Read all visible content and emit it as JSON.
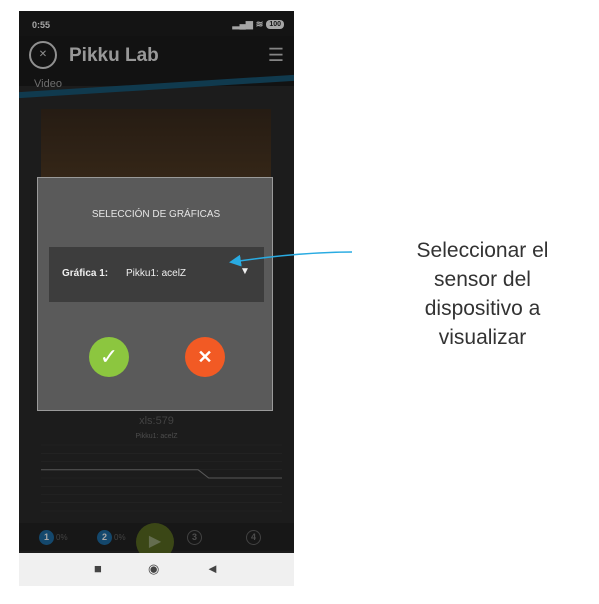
{
  "status": {
    "time": "0:55",
    "signal_icon": "signal-icon",
    "wifi_icon": "wifi-icon",
    "battery": "100"
  },
  "app": {
    "title": "Pikku Lab",
    "subtitle": "Video",
    "logo_icon": "pikku-logo-icon",
    "settings_icon": "sliders-icon"
  },
  "dialog": {
    "title": "SELECCIÓN DE GRÁFICAS",
    "graph_label": "Gráfica 1:",
    "graph_value": "Pikku1: acelZ",
    "confirm_icon": "check-icon",
    "cancel_icon": "close-icon"
  },
  "chart": {
    "header": "xls:579",
    "title": "Pikku1: acelZ"
  },
  "chart_data": {
    "type": "line",
    "title": "Pikku1: acelZ",
    "series": [
      {
        "values": [
          1,
          1,
          1,
          1,
          1,
          1,
          1,
          1,
          1,
          1,
          1,
          1,
          1,
          1,
          1,
          1,
          0,
          0,
          0,
          0,
          0,
          0,
          0,
          0
        ]
      }
    ],
    "ylim": [
      -4,
      4
    ],
    "grid": true
  },
  "bottom": {
    "slot1": "1",
    "slot1_pct": "0%",
    "slot2": "2",
    "slot2_pct": "0%",
    "slot3": "3",
    "slot4": "4",
    "play_icon": "play-icon"
  },
  "nav": {
    "recent": "■",
    "home": "◉",
    "back": "◄"
  },
  "annotation": {
    "text": "Seleccionar el sensor del dispositivo a visualizar"
  },
  "colors": {
    "accent": "#1a5a78",
    "ok": "#8cc63f",
    "cancel": "#f25a24",
    "arrow": "#29abe2"
  }
}
